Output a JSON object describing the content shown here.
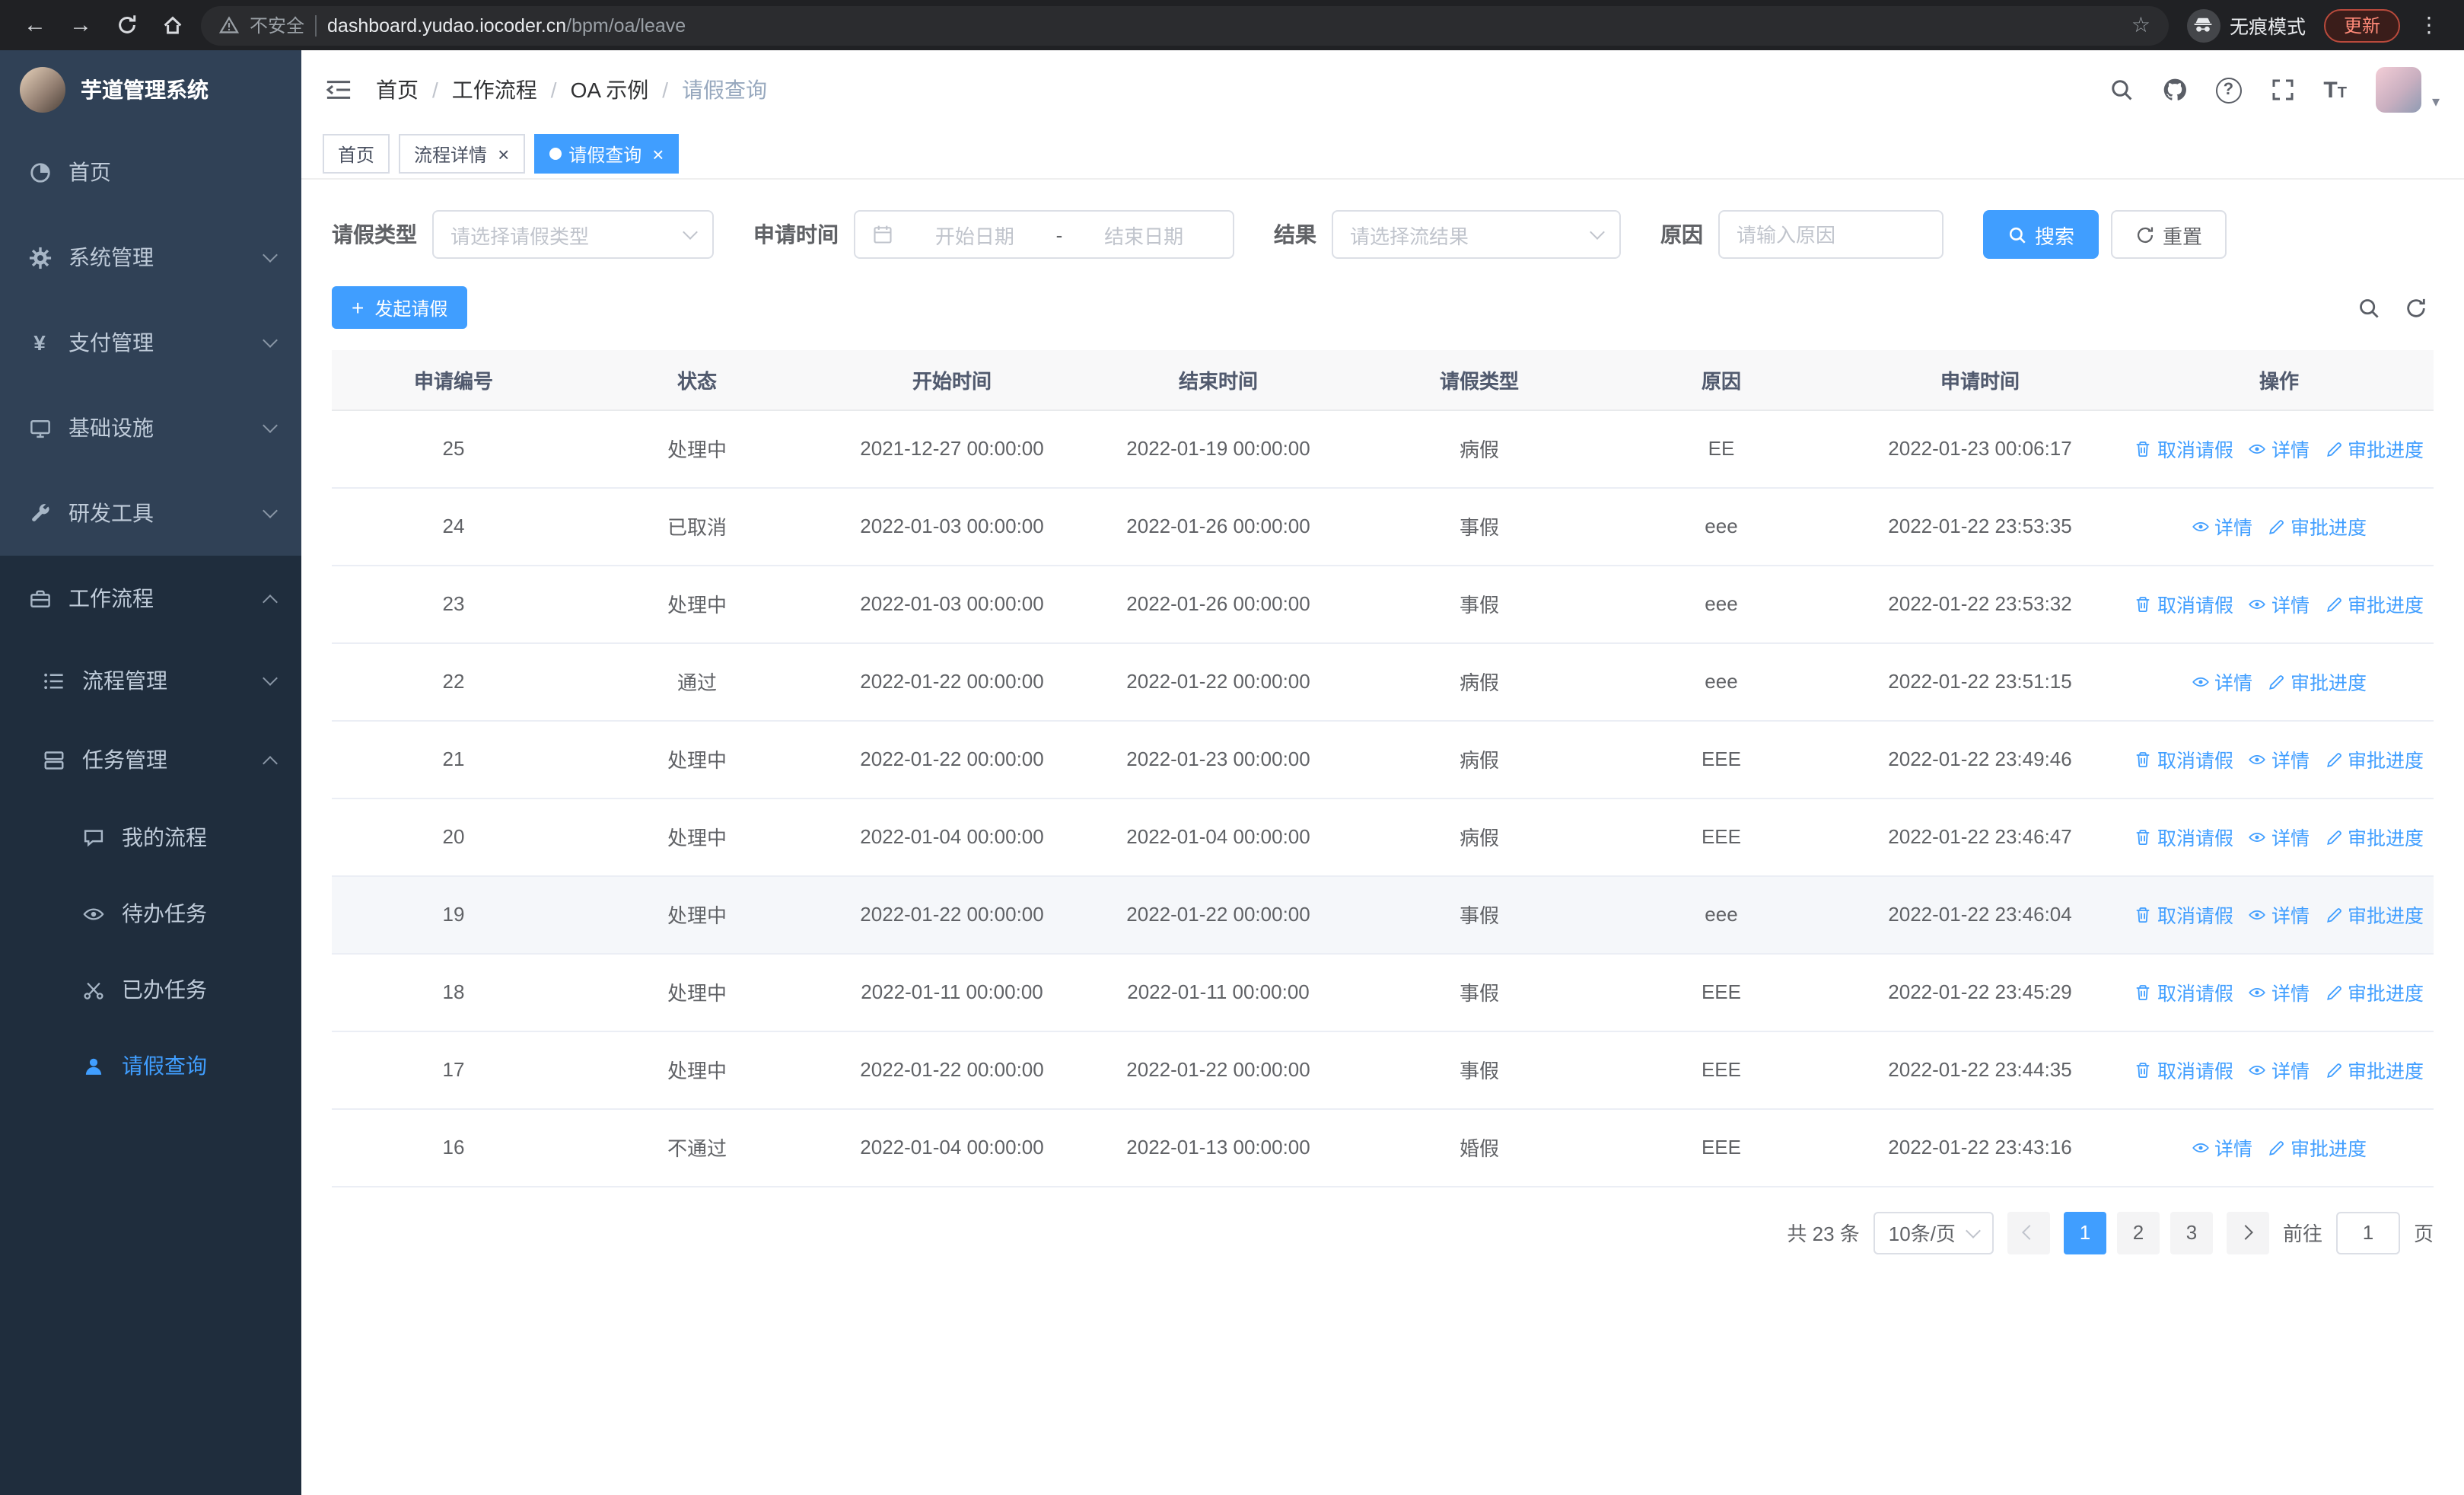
{
  "browser": {
    "security_warning": "不安全",
    "url_domain": "dashboard.yudao.iocoder.cn",
    "url_path": "/bpm/oa/leave",
    "incognito_label": "无痕模式",
    "update_label": "更新"
  },
  "icons": {
    "back": "←",
    "forward": "→",
    "star": "☆",
    "menu_dots": "⋮",
    "close": "×",
    "plus": "+",
    "caret_down": "▾",
    "help": "?",
    "font_large": "T",
    "font_small": "T",
    "currency": "¥"
  },
  "sidebar": {
    "logo_title": "芋道管理系统",
    "home": "首页",
    "system": "系统管理",
    "payment": "支付管理",
    "infra": "基础设施",
    "devtools": "研发工具",
    "workflow": "工作流程",
    "process_mgmt": "流程管理",
    "task_mgmt": "任务管理",
    "my_process": "我的流程",
    "todo_tasks": "待办任务",
    "done_tasks": "已办任务",
    "leave_query": "请假查询"
  },
  "header": {
    "breadcrumbs": [
      "首页",
      "工作流程",
      "OA 示例",
      "请假查询"
    ],
    "separator": "/"
  },
  "tabs": [
    {
      "label": "首页",
      "closable": false,
      "active": false
    },
    {
      "label": "流程详情",
      "closable": true,
      "active": false
    },
    {
      "label": "请假查询",
      "closable": true,
      "active": true
    }
  ],
  "filters": {
    "leave_type_label": "请假类型",
    "leave_type_placeholder": "请选择请假类型",
    "apply_time_label": "申请时间",
    "date_start_placeholder": "开始日期",
    "date_separator": "-",
    "date_end_placeholder": "结束日期",
    "result_label": "结果",
    "result_placeholder": "请选择流结果",
    "reason_label": "原因",
    "reason_placeholder": "请输入原因",
    "search_label": "搜索",
    "reset_label": "重置"
  },
  "toolbar": {
    "create_label": "发起请假"
  },
  "table": {
    "columns": [
      "申请编号",
      "状态",
      "开始时间",
      "结束时间",
      "请假类型",
      "原因",
      "申请时间",
      "操作"
    ],
    "action_labels": {
      "cancel": "取消请假",
      "detail": "详情",
      "progress": "审批进度"
    },
    "rows": [
      {
        "id": "25",
        "status": "处理中",
        "start_time": "2021-12-27 00:00:00",
        "end_time": "2022-01-19 00:00:00",
        "leave_type": "病假",
        "reason": "EE",
        "apply_time": "2022-01-23 00:06:17",
        "cancellable": true,
        "highlighted": false
      },
      {
        "id": "24",
        "status": "已取消",
        "start_time": "2022-01-03 00:00:00",
        "end_time": "2022-01-26 00:00:00",
        "leave_type": "事假",
        "reason": "eee",
        "apply_time": "2022-01-22 23:53:35",
        "cancellable": false,
        "highlighted": false
      },
      {
        "id": "23",
        "status": "处理中",
        "start_time": "2022-01-03 00:00:00",
        "end_time": "2022-01-26 00:00:00",
        "leave_type": "事假",
        "reason": "eee",
        "apply_time": "2022-01-22 23:53:32",
        "cancellable": true,
        "highlighted": false
      },
      {
        "id": "22",
        "status": "通过",
        "start_time": "2022-01-22 00:00:00",
        "end_time": "2022-01-22 00:00:00",
        "leave_type": "病假",
        "reason": "eee",
        "apply_time": "2022-01-22 23:51:15",
        "cancellable": false,
        "highlighted": false
      },
      {
        "id": "21",
        "status": "处理中",
        "start_time": "2022-01-22 00:00:00",
        "end_time": "2022-01-23 00:00:00",
        "leave_type": "病假",
        "reason": "EEE",
        "apply_time": "2022-01-22 23:49:46",
        "cancellable": true,
        "highlighted": false
      },
      {
        "id": "20",
        "status": "处理中",
        "start_time": "2022-01-04 00:00:00",
        "end_time": "2022-01-04 00:00:00",
        "leave_type": "病假",
        "reason": "EEE",
        "apply_time": "2022-01-22 23:46:47",
        "cancellable": true,
        "highlighted": false
      },
      {
        "id": "19",
        "status": "处理中",
        "start_time": "2022-01-22 00:00:00",
        "end_time": "2022-01-22 00:00:00",
        "leave_type": "事假",
        "reason": "eee",
        "apply_time": "2022-01-22 23:46:04",
        "cancellable": true,
        "highlighted": true
      },
      {
        "id": "18",
        "status": "处理中",
        "start_time": "2022-01-11 00:00:00",
        "end_time": "2022-01-11 00:00:00",
        "leave_type": "事假",
        "reason": "EEE",
        "apply_time": "2022-01-22 23:45:29",
        "cancellable": true,
        "highlighted": false
      },
      {
        "id": "17",
        "status": "处理中",
        "start_time": "2022-01-22 00:00:00",
        "end_time": "2022-01-22 00:00:00",
        "leave_type": "事假",
        "reason": "EEE",
        "apply_time": "2022-01-22 23:44:35",
        "cancellable": true,
        "highlighted": false
      },
      {
        "id": "16",
        "status": "不通过",
        "start_time": "2022-01-04 00:00:00",
        "end_time": "2022-01-13 00:00:00",
        "leave_type": "婚假",
        "reason": "EEE",
        "apply_time": "2022-01-22 23:43:16",
        "cancellable": false,
        "highlighted": false
      }
    ]
  },
  "pagination": {
    "total_text": "共 23 条",
    "page_size": "10条/页",
    "pages": [
      "1",
      "2",
      "3"
    ],
    "active_page": "1",
    "goto_label": "前往",
    "goto_value": "1",
    "page_suffix": "页"
  },
  "colors": {
    "primary": "#409eff",
    "sidebar_bg": "#1f2d3d",
    "sidebar_item_bg": "#304156",
    "table_header_bg": "#f8f8f9"
  }
}
